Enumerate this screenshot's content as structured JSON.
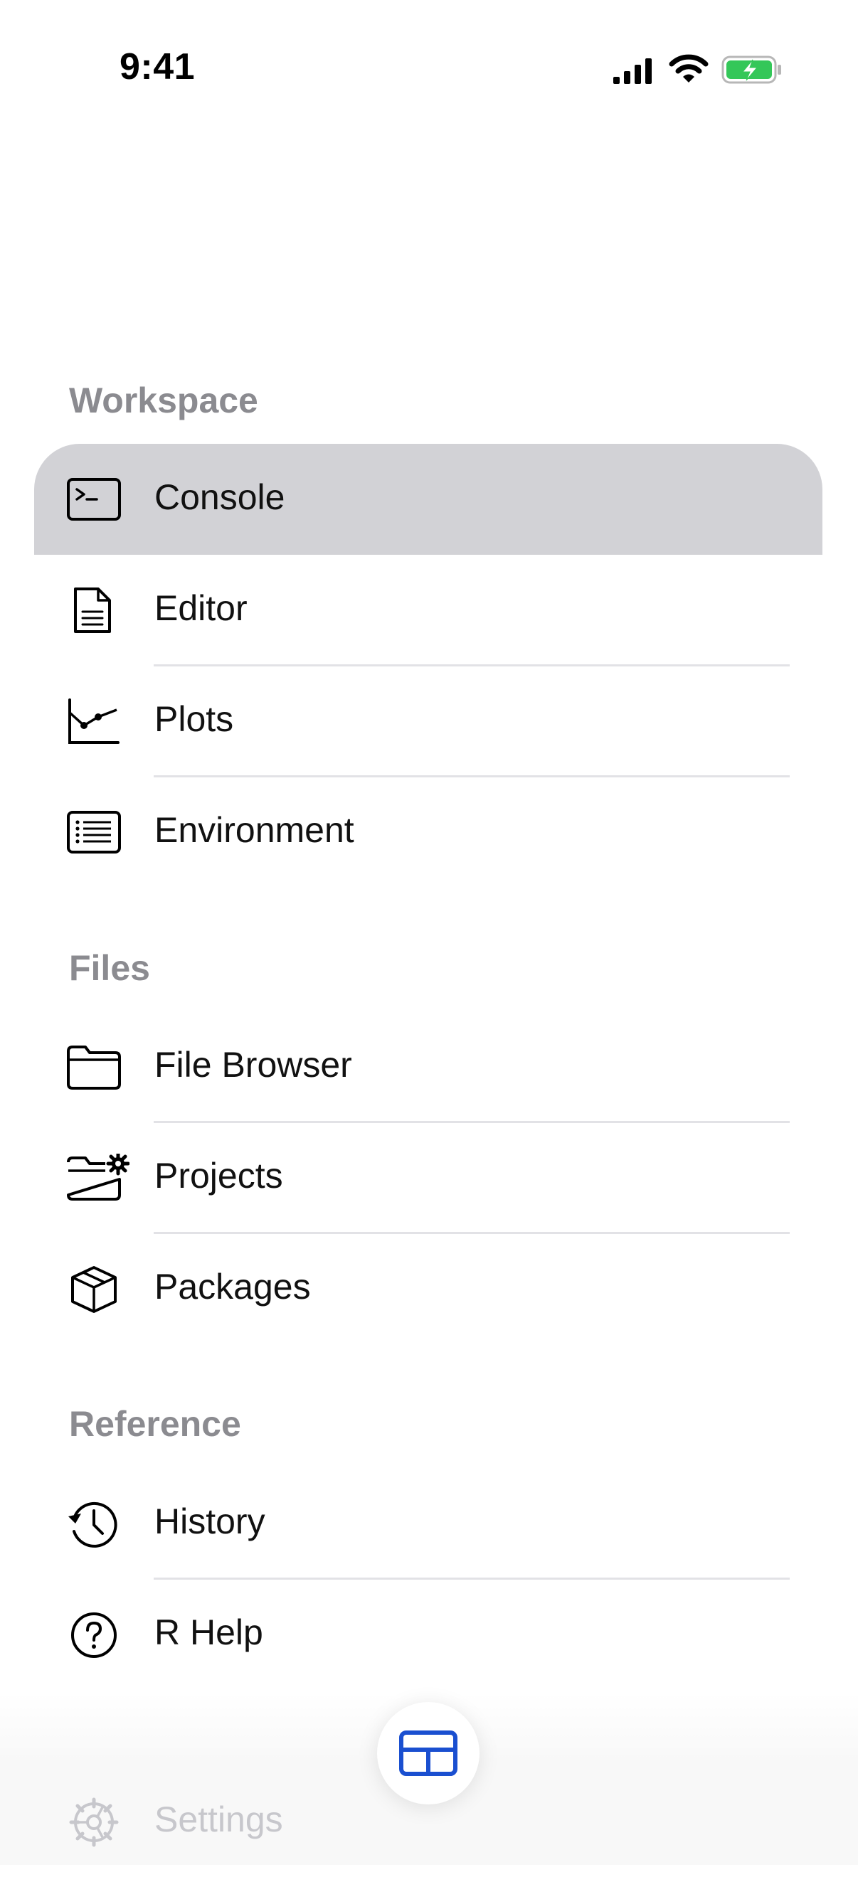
{
  "status_bar": {
    "time": "9:41"
  },
  "sections": {
    "workspace": {
      "title": "Workspace",
      "items": [
        {
          "label": "Console",
          "icon": "terminal-icon",
          "selected": true
        },
        {
          "label": "Editor",
          "icon": "document-icon"
        },
        {
          "label": "Plots",
          "icon": "chart-line-icon"
        },
        {
          "label": "Environment",
          "icon": "list-icon"
        }
      ]
    },
    "files": {
      "title": "Files",
      "items": [
        {
          "label": "File Browser",
          "icon": "folder-icon"
        },
        {
          "label": "Projects",
          "icon": "folder-gear-icon"
        },
        {
          "label": "Packages",
          "icon": "package-icon"
        }
      ]
    },
    "reference": {
      "title": "Reference",
      "items": [
        {
          "label": "History",
          "icon": "history-icon"
        },
        {
          "label": "R Help",
          "icon": "help-circle-icon"
        }
      ]
    }
  },
  "settings": {
    "label": "Settings",
    "icon": "gear-icon"
  },
  "layout_button": {
    "icon": "grid-layout-icon",
    "accent": "#1a4fd0"
  },
  "colors": {
    "selected_background": "#d2d2d6",
    "section_title": "#8b8b90",
    "divider": "#e2e2e6",
    "battery_fill": "#34c759"
  }
}
